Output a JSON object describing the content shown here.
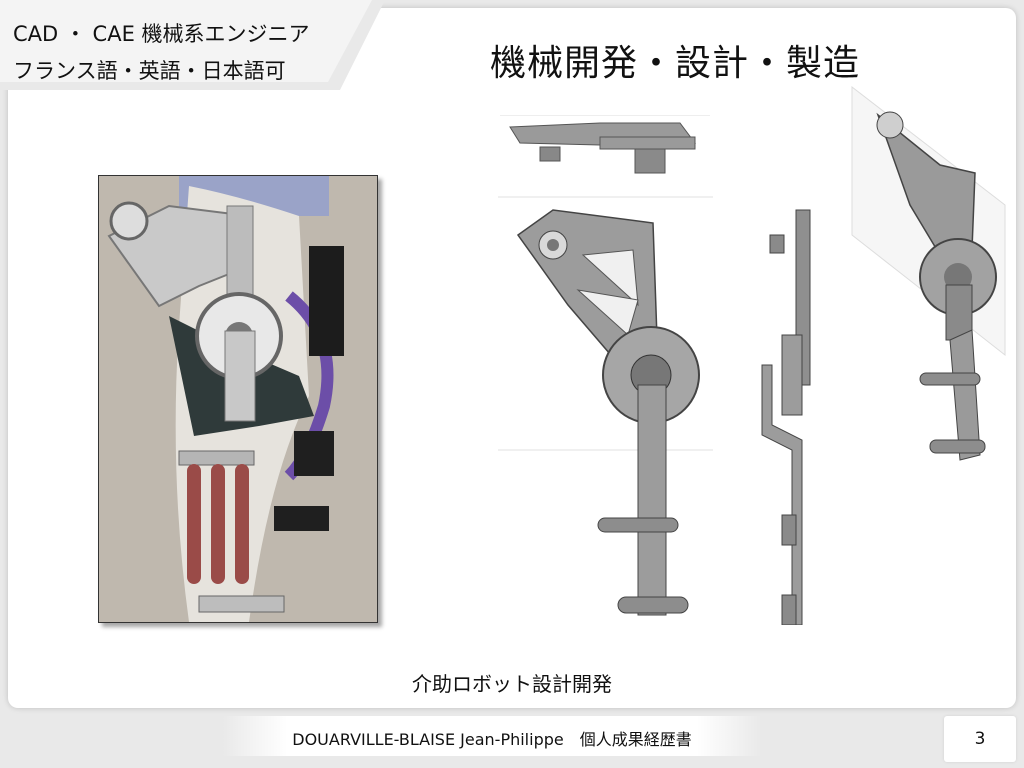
{
  "corner_tag": {
    "line1": "CAD ・ CAE 機械系エンジニア",
    "line2": "フランス語・英語・日本語可"
  },
  "page_title": "機械開発・設計・製造",
  "photo": {
    "subject": "exoskeleton-prototype"
  },
  "drawings": {
    "views": [
      "top-view",
      "front-view",
      "side-view",
      "isometric-view"
    ]
  },
  "caption": "介助ロボット設計開発",
  "footer": {
    "name": "DOUARVILLE-BLAISE Jean-Philippe　個人成果経歴書",
    "page_number": "3"
  },
  "colors": {
    "background": "#e9e9e9",
    "frame": "#ffffff",
    "metal": "#8a8a8a",
    "metal_dark": "#555555"
  }
}
